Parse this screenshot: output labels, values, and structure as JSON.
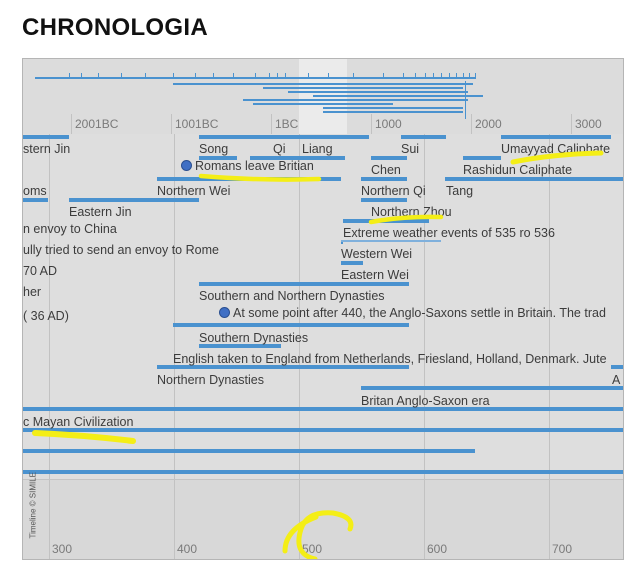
{
  "page": {
    "heading": "CHRONOLOGIA"
  },
  "timeline": {
    "overview_years": [
      "2001BC",
      "1001BC",
      "1BC",
      "1000",
      "2000",
      "3000"
    ],
    "bottom_years": [
      "300",
      "400",
      "500",
      "600",
      "700"
    ],
    "copyright": "Timeline © SIMILE",
    "events": [
      "stern Jin",
      "Song",
      "Qi",
      "Liang",
      "Sui",
      "Umayyad Caliphate",
      "Romans leave Britian",
      "Chen",
      "Rashidun Caliphate",
      "oms",
      "Northern Wei",
      "Northern Qi",
      "Tang",
      "Eastern Jin",
      "Northern Zhou",
      "n envoy to China",
      "Extreme weather events of 535 ro 536",
      "ully tried to send an envoy to Rome",
      "Western Wei",
      "70 AD",
      "Eastern Wei",
      "her",
      "Southern and Northern Dynasties",
      "36 AD)",
      "At some point after 440, the Anglo-Saxons settle in Britain. The trad",
      "Southern Dynasties",
      "English taken to England from Netherlands, Friesland, Holland, Denmark. Jute",
      "Northern Dynasties",
      "A",
      "Britan Anglo-Saxon era",
      "c Mayan Civilization"
    ]
  },
  "colors": {
    "bar": "#4a92cf",
    "highlight": "#f4ee16",
    "band": "#dedede"
  }
}
